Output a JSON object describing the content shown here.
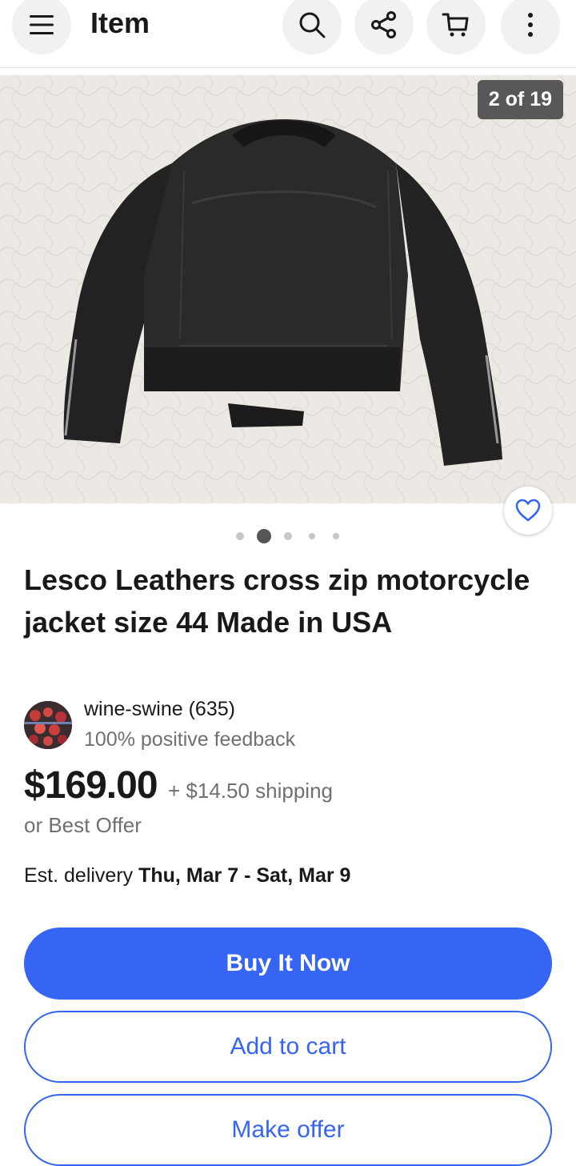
{
  "header": {
    "title": "Item",
    "icons": [
      "menu-icon",
      "search-icon",
      "share-icon",
      "cart-icon",
      "more-icon"
    ]
  },
  "gallery": {
    "counter": "2 of 19",
    "dots_total": 5,
    "dots_active_index": 1
  },
  "item": {
    "title": "Lesco Leathers cross zip motorcycle jacket size 44 Made in USA"
  },
  "seller": {
    "name": "wine-swine (635)",
    "feedback": "100% positive feedback"
  },
  "pricing": {
    "price": "$169.00",
    "shipping": "+ $14.50 shipping",
    "best_offer": "or Best Offer"
  },
  "delivery": {
    "label": "Est. delivery",
    "dates": "Thu, Mar 7 - Sat, Mar 9"
  },
  "actions": {
    "buy_now": "Buy It Now",
    "add_to_cart": "Add to cart",
    "make_offer": "Make offer"
  },
  "colors": {
    "accent": "#3665f3",
    "text_primary": "#191919",
    "text_secondary": "#707070",
    "counter_bg": "#585858"
  }
}
